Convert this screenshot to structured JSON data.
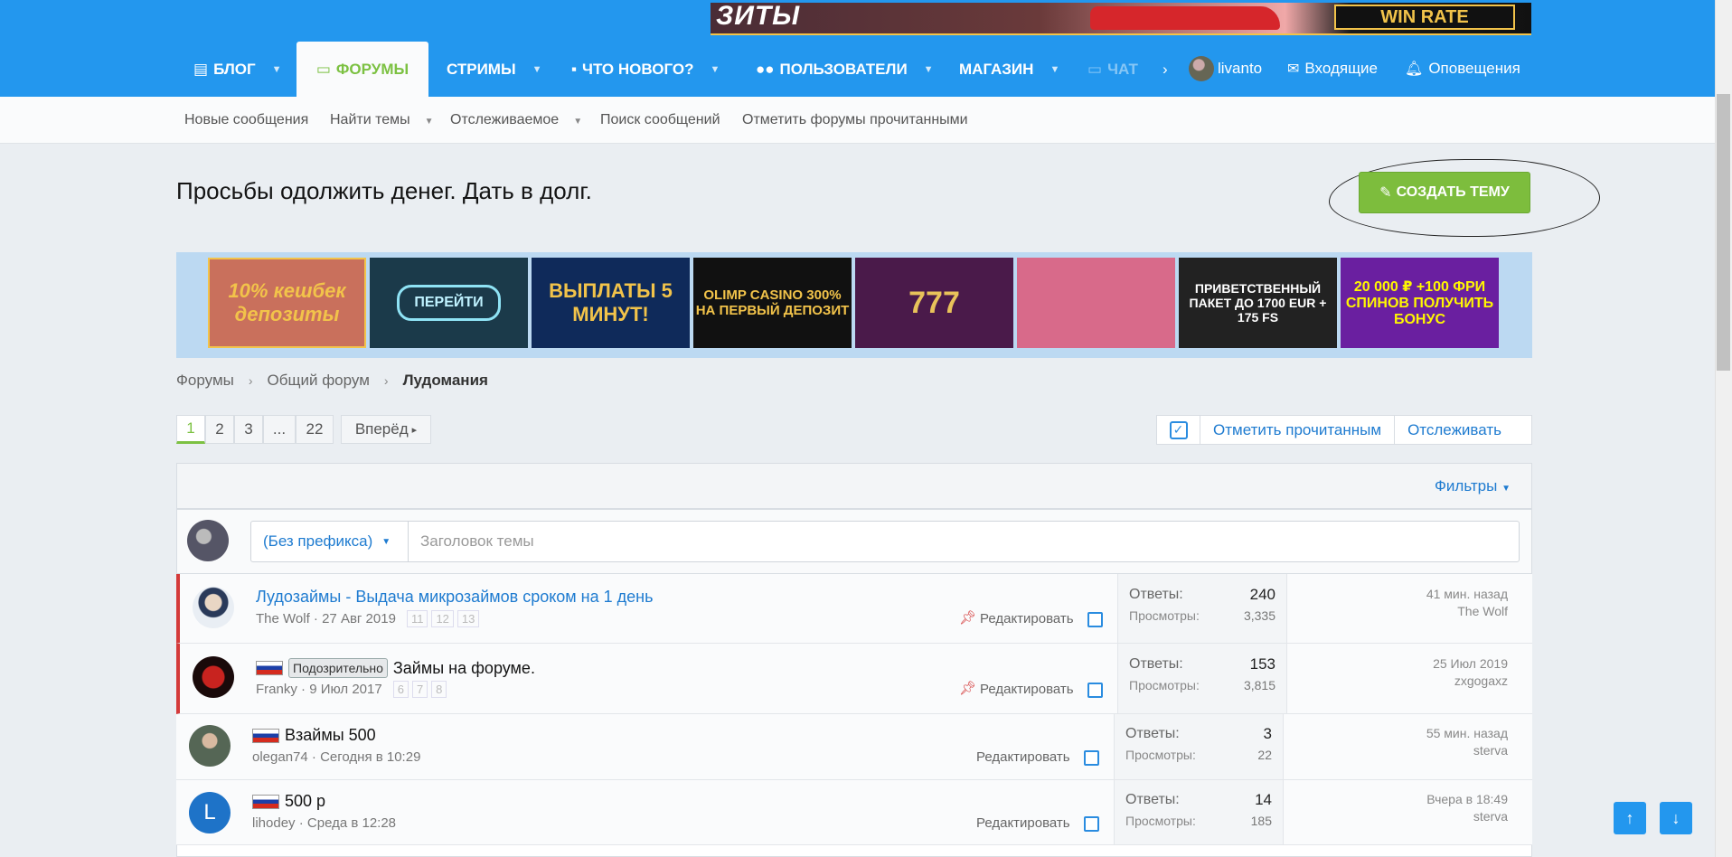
{
  "top_banner": {
    "left_text": "ЗИТЫ",
    "right_text": "WIN RATE"
  },
  "nav": {
    "items": [
      {
        "label": "БЛОГ",
        "icon": "book-icon"
      },
      {
        "label": "ФОРУМЫ",
        "icon": "forum-icon",
        "active": true
      },
      {
        "label": "СТРИМЫ"
      },
      {
        "label": "ЧТО НОВОГО?",
        "icon": "comment-icon"
      },
      {
        "label": "ПОЛЬЗОВАТЕЛИ",
        "icon": "users-icon"
      },
      {
        "label": "МАГАЗИН"
      },
      {
        "label": "ЧАТ",
        "icon": "chat-icon"
      }
    ],
    "username": "livanto",
    "inbox": "Входящие",
    "alerts": "Оповещения"
  },
  "subnav": [
    "Новые сообщения",
    "Найти темы",
    "Отслеживаемое",
    "Поиск сообщений",
    "Отметить форумы прочитанными"
  ],
  "page_title": "Просьбы одолжить денег. Дать в долг.",
  "create_button": "СОЗДАТЬ ТЕМУ",
  "ads": [
    {
      "text": "10% кешбек депозиты",
      "bg": "#c9705c"
    },
    {
      "text": "ПЕРЕЙТИ",
      "bg": "#1b3a4a"
    },
    {
      "text": "ВЫПЛАТЫ 5 МИНУТ!",
      "bg": "#0f2a5a"
    },
    {
      "text": "OLIMP CASINO 300% НА ПЕРВЫЙ ДЕПОЗИТ",
      "bg": "#111111"
    },
    {
      "text": "777",
      "bg": "#4a1a4a"
    },
    {
      "text": "",
      "bg": "#d86a8a"
    },
    {
      "text": "ПРИВЕТСТВЕННЫЙ ПАКЕТ ДО 1700 EUR + 175 FS",
      "bg": "#222222"
    },
    {
      "text": "20 000 ₽ +100 ФРИ СПИНОВ ПОЛУЧИТЬ БОНУС",
      "bg": "#6a1fa0"
    }
  ],
  "breadcrumb": {
    "items": [
      "Форумы",
      "Общий форум"
    ],
    "current": "Лудомания"
  },
  "pagination": {
    "pages": [
      "1",
      "2",
      "3",
      "...",
      "22"
    ],
    "next": "Вперёд"
  },
  "actions": {
    "mark_read": "Отметить прочитанным",
    "watch": "Отслеживать"
  },
  "filters": "Фильтры",
  "new_thread": {
    "prefix": "(Без префикса)",
    "placeholder": "Заголовок темы"
  },
  "threads": [
    {
      "title": "Лудозаймы - Выдача микрозаймов сроком на 1 день",
      "author": "The Wolf",
      "date": "27 Авг 2019",
      "pages": [
        "11",
        "12",
        "13"
      ],
      "sticky": true,
      "flag": false,
      "badge": "",
      "edit": "Редактировать",
      "replies_label": "Ответы:",
      "replies": "240",
      "views_label": "Просмотры:",
      "views": "3,335",
      "last_time": "41 мин. назад",
      "last_user": "The Wolf"
    },
    {
      "title": "Займы на форуме.",
      "author": "Franky",
      "date": "9 Июл 2017",
      "pages": [
        "6",
        "7",
        "8"
      ],
      "sticky": true,
      "flag": true,
      "badge": "Подозрительно",
      "edit": "Редактировать",
      "replies_label": "Ответы:",
      "replies": "153",
      "views_label": "Просмотры:",
      "views": "3,815",
      "last_time": "25 Июл 2019",
      "last_user": "zxgogaxz"
    },
    {
      "title": "Взаймы 500",
      "author": "olegan74",
      "date": "Сегодня в 10:29",
      "pages": [],
      "sticky": false,
      "flag": true,
      "badge": "",
      "edit": "Редактировать",
      "replies_label": "Ответы:",
      "replies": "3",
      "views_label": "Просмотры:",
      "views": "22",
      "last_time": "55 мин. назад",
      "last_user": "sterva"
    },
    {
      "title": "500 р",
      "author": "lihodey",
      "date": "Среда в 12:28",
      "pages": [],
      "sticky": false,
      "flag": true,
      "badge": "",
      "edit": "Редактировать",
      "replies_label": "Ответы:",
      "replies": "14",
      "views_label": "Просмотры:",
      "views": "185",
      "last_time": "Вчера в 18:49",
      "last_user": "sterva",
      "avatar_letter": "L"
    }
  ]
}
